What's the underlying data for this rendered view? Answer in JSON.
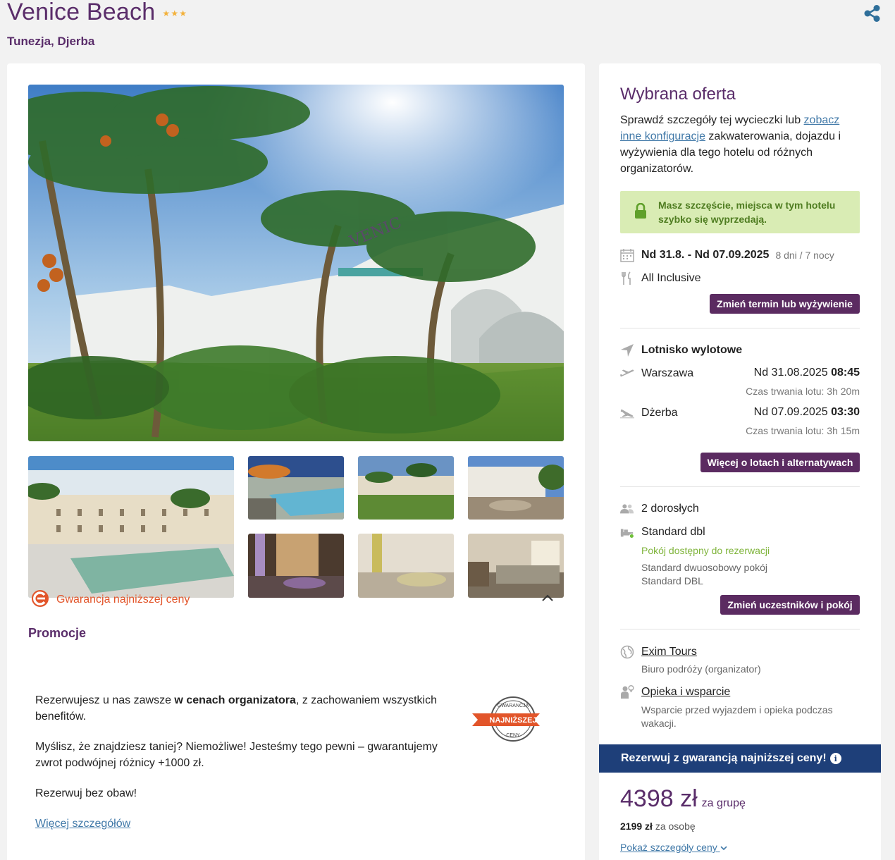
{
  "header": {
    "hotel_name": "Venice Beach",
    "stars": [
      "★",
      "★",
      "★"
    ],
    "location": "Tunezja, Djerba",
    "share_icon": "share-icon"
  },
  "gallery": {
    "main_image": "hotel-exterior-palms",
    "thumbnails": [
      "pool-courtyard",
      "pool-loungers",
      "garden-buildings",
      "rocky-garden",
      "lobby-lounge",
      "restaurant-hall",
      "guest-room"
    ]
  },
  "promotions": {
    "heading": "Promocje",
    "item_label": "Gwarancja najniższej ceny",
    "p1_pre": "Rezerwujesz u nas zawsze ",
    "p1_bold": "w cenach organizatora",
    "p1_post": ", z zachowaniem wszystkich benefitów.",
    "p2": "Myślisz, że znajdziesz taniej? Niemożliwe! Jesteśmy tego pewni – gwarantujemy zwrot podwójnej różnicy +1000 zł.",
    "p3": "Rezerwuj bez obaw!",
    "more_link": "Więcej szczegółów",
    "badge_top": "GWARANCJA",
    "badge_middle": "NAJNIŻSZEJ",
    "badge_bottom": "CENY"
  },
  "offer": {
    "title": "Wybrana oferta",
    "intro_pre": "Sprawdź szczegóły tej wycieczki lub ",
    "intro_link": "zobacz inne konfiguracje",
    "intro_post": " zakwaterowania, dojazdu i wyżywienia dla tego hotelu od różnych organizatorów.",
    "alert": "Masz szczęście, miejsca w tym hotelu szybko się wyprzedają.",
    "dates": "Nd 31.8. - Nd 07.09.2025",
    "duration": "8 dni / 7 nocy",
    "board": "All Inclusive",
    "change_term_button": "Zmień termin lub wyżywienie",
    "airport_label": "Lotnisko wylotowe",
    "outbound_city": "Warszawa",
    "outbound_date": "Nd 31.08.2025",
    "outbound_time": "08:45",
    "outbound_duration": "Czas trwania lotu: 3h 20m",
    "return_city": "Dżerba",
    "return_date": "Nd 07.09.2025",
    "return_time": "03:30",
    "return_duration": "Czas trwania lotu: 3h 15m",
    "flights_button": "Więcej o lotach i alternatywach",
    "travellers": "2 dorosłych",
    "room_name": "Standard dbl",
    "room_available": "Pokój dostępny do rezerwacji",
    "room_desc1": "Standard dwuosobowy pokój",
    "room_desc2": "Standard DBL",
    "change_room_button": "Zmień uczestników i pokój",
    "organizer_link": "Exim Tours",
    "organizer_desc": "Biuro podróży (organizator)",
    "support_link": "Opieka i wsparcie",
    "support_desc": "Wsparcie przed wyjazdem i opieka podczas wakacji."
  },
  "pricing": {
    "guarantee_bar": "Rezerwuj z gwarancją najniższej ceny!",
    "info_icon": "i",
    "total": "4398 zł",
    "total_unit": "za grupę",
    "per_person": "2199 zł",
    "per_person_unit": "za osobę",
    "details_link": "Pokaż szczegóły ceny"
  }
}
